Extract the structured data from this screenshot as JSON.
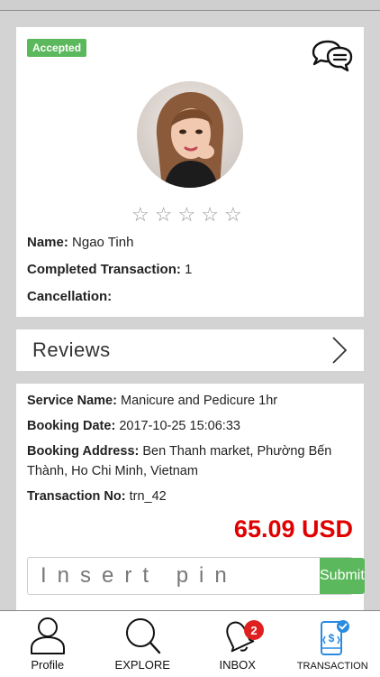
{
  "profile": {
    "status_badge": "Accepted",
    "rating_stars": 0,
    "name_label": "Name:",
    "name_value": "Ngao Tinh",
    "completed_label": "Completed Transaction:",
    "completed_value": "1",
    "cancellation_label": "Cancellation:",
    "cancellation_value": "",
    "chat_icon": "chat-bubbles-icon"
  },
  "reviews": {
    "title": "Reviews",
    "icon": "chevron-right-icon"
  },
  "transaction": {
    "service_label": "Service Name:",
    "service_value": "Manicure and Pedicure 1hr",
    "date_label": "Booking Date:",
    "date_value": "2017-10-25 15:06:33",
    "address_label": "Booking Address:",
    "address_value": "Ben Thanh market, Phường Bến Thành, Ho Chi Minh, Vietnam",
    "number_label": "Transaction No:",
    "number_value": "trn_42",
    "price": "65.09 USD",
    "pin_placeholder": "Insert pin",
    "submit_label": "Submit"
  },
  "tabbar": {
    "tabs": [
      {
        "label": "Profile",
        "icon": "person-icon"
      },
      {
        "label": "EXPLORE",
        "icon": "search-icon"
      },
      {
        "label": "INBOX",
        "icon": "bell-icon",
        "badge": "2"
      },
      {
        "label": "TRANSACTION",
        "icon": "phone-payment-icon",
        "active": true
      }
    ]
  },
  "colors": {
    "accent_green": "#5cb85c",
    "price_red": "#e00000",
    "badge_red": "#e02020",
    "active_blue": "#2a8be0"
  }
}
